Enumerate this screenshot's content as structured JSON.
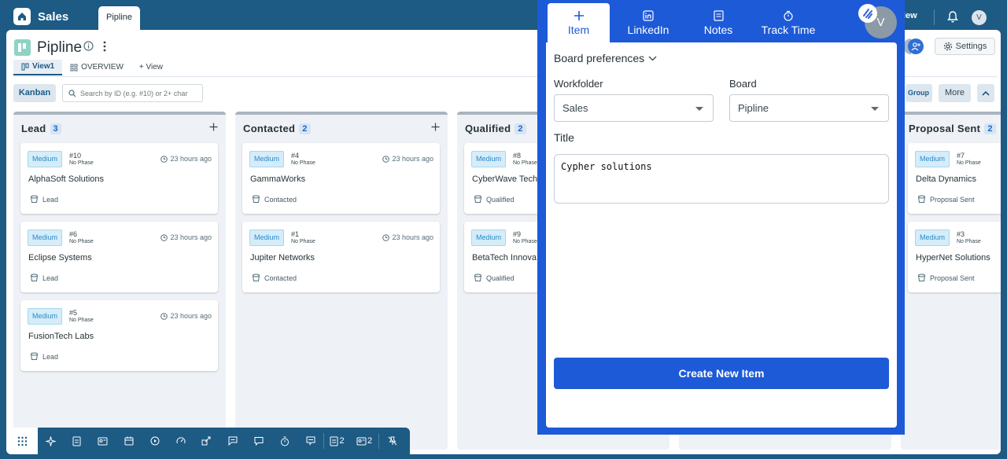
{
  "topbar": {
    "home_icon": "home-icon",
    "workspace": "Sales",
    "tab": "Pipline",
    "right_view": "iew",
    "avatar": "V"
  },
  "board": {
    "title": "Pipline",
    "tabs": [
      {
        "label": "View1"
      },
      {
        "label": "OVERVIEW"
      },
      {
        "label": "+ View"
      }
    ],
    "kanban": "Kanban",
    "search_placeholder": "Search by ID (e.g. #10) or 2+ char",
    "group": "Group",
    "more": "More",
    "settings": "Settings"
  },
  "columns": [
    {
      "title": "Lead",
      "count": "3",
      "cards": [
        {
          "priority": "Medium",
          "id": "#10",
          "phase": "No Phase",
          "time": "23 hours ago",
          "name": "AlphaSoft Solutions",
          "status": "Lead"
        },
        {
          "priority": "Medium",
          "id": "#6",
          "phase": "No Phase",
          "time": "23 hours ago",
          "name": "Eclipse Systems",
          "status": "Lead"
        },
        {
          "priority": "Medium",
          "id": "#5",
          "phase": "No Phase",
          "time": "23 hours ago",
          "name": "FusionTech Labs",
          "status": "Lead"
        }
      ]
    },
    {
      "title": "Contacted",
      "count": "2",
      "cards": [
        {
          "priority": "Medium",
          "id": "#4",
          "phase": "No Phase",
          "time": "23 hours ago",
          "name": "GammaWorks",
          "status": "Contacted"
        },
        {
          "priority": "Medium",
          "id": "#1",
          "phase": "No Phase",
          "time": "23 hours ago",
          "name": "Jupiter Networks",
          "status": "Contacted"
        }
      ]
    },
    {
      "title": "Qualified",
      "count": "2",
      "cards": [
        {
          "priority": "Medium",
          "id": "#8",
          "phase": "No Phase",
          "time": "",
          "name": "CyberWave Tech",
          "status": "Qualified"
        },
        {
          "priority": "Medium",
          "id": "#9",
          "phase": "No Phase",
          "time": "",
          "name": "BetaTech Innova",
          "status": "Qualified"
        }
      ]
    },
    {
      "title": "Proposal Sent",
      "count": "2",
      "cards": [
        {
          "priority": "Medium",
          "id": "#7",
          "phase": "No Phase",
          "time": "",
          "name": "Delta Dynamics",
          "status": "Proposal Sent"
        },
        {
          "priority": "Medium",
          "id": "#3",
          "phase": "No Phase",
          "time": "",
          "name": "HyperNet Solutions",
          "status": "Proposal Sent"
        }
      ]
    }
  ],
  "toolbar": {
    "count_a": "2",
    "count_b": "2"
  },
  "panel": {
    "tabs": [
      {
        "label": "Item",
        "icon": "plus-icon"
      },
      {
        "label": "LinkedIn",
        "icon": "linkedin-icon"
      },
      {
        "label": "Notes",
        "icon": "notes-icon"
      },
      {
        "label": "Track Time",
        "icon": "stopwatch-icon"
      }
    ],
    "avatar": "V",
    "board_preferences": "Board preferences",
    "workfolder_label": "Workfolder",
    "workfolder_value": "Sales",
    "board_label": "Board",
    "board_value": "Pipline",
    "title_label": "Title",
    "title_value": "Cypher solutions",
    "create_button": "Create New Item"
  },
  "colors": {
    "topbar": "#1d5a84",
    "panel_accent": "#1d5ad8",
    "badge": "#d5edf9"
  }
}
